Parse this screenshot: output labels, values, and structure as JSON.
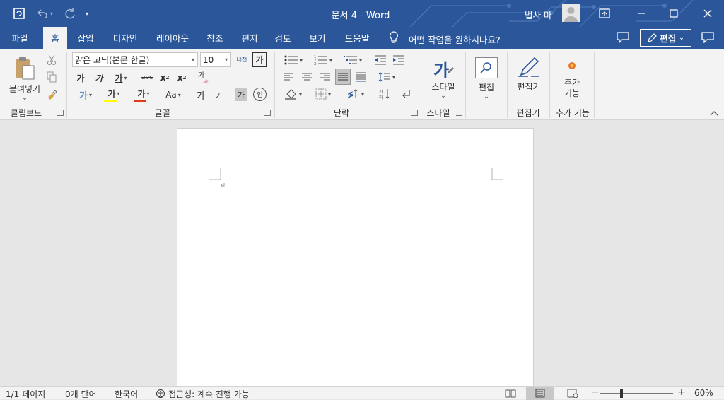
{
  "titlebar": {
    "title": "문서 4  -  Word",
    "user": "법사 마"
  },
  "tabs": [
    {
      "label": "파일"
    },
    {
      "label": "홈"
    },
    {
      "label": "삽입"
    },
    {
      "label": "디자인"
    },
    {
      "label": "레이아웃"
    },
    {
      "label": "참조"
    },
    {
      "label": "편지"
    },
    {
      "label": "검토"
    },
    {
      "label": "보기"
    },
    {
      "label": "도움말"
    }
  ],
  "tellme": "어떤 작업을 원하시나요?",
  "edit_mode": "편집",
  "ribbon": {
    "clipboard": {
      "paste": "붙여넣기",
      "label": "클립보드"
    },
    "font": {
      "name": "맑은 고딕(본문 한글)",
      "size": "10",
      "label": "글꼴",
      "bold": "가",
      "italic": "가",
      "underline": "가",
      "strike": "abc",
      "sub": "x",
      "sup": "x",
      "effects": "가",
      "highlight": "가",
      "color": "가",
      "case": "Aa",
      "grow": "가",
      "shrink": "가",
      "shade": "가",
      "enclose": "인",
      "phonetic": "내천",
      "charborder": "가"
    },
    "paragraph": {
      "label": "단락"
    },
    "styles": {
      "btn": "스타일",
      "label": "스타일"
    },
    "editing": {
      "btn": "편집"
    },
    "editor": {
      "btn": "편집기",
      "label": "편집기"
    },
    "addins": {
      "btn": "추가 기능",
      "label": "추가 기능"
    }
  },
  "status": {
    "page": "1/1 페이지",
    "words": "0개 단어",
    "lang": "한국어",
    "access": "접근성: 계속 진행 가능",
    "zoom": "60%"
  },
  "colors": {
    "brand": "#2b579a",
    "highlight": "#ffff00",
    "fontcolor": "#e03a1a"
  }
}
